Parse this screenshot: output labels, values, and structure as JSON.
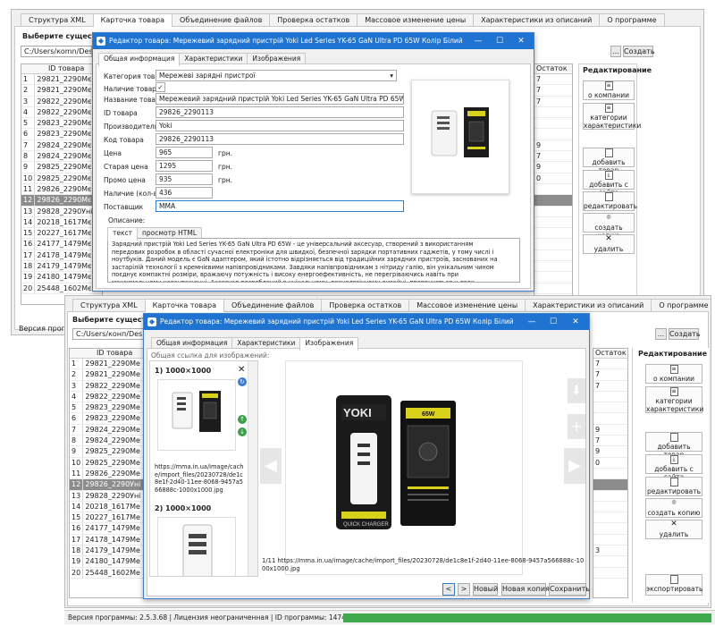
{
  "main_tabs": [
    "Структура XML",
    "Карточка товара",
    "Объединение файлов",
    "Проверка остатков",
    "Массовое изменение цены",
    "Характеристики из описаний",
    "О программе"
  ],
  "select_label": "Выберите существую",
  "path_value": "C:/Users/коmn/Desktop",
  "path2_value": "C:/Users/конп/Desktop",
  "browse_label": "...",
  "create_label": "Создать",
  "col_id": "ID товара",
  "col_stock": "Остаток",
  "rows1": [
    {
      "n": "1",
      "id": "29821_2290...",
      "m": "Мє",
      "s": "7"
    },
    {
      "n": "2",
      "id": "29821_2290...",
      "m": "Мє",
      "s": "7"
    },
    {
      "n": "3",
      "id": "29822_2290...",
      "m": "Мє",
      "s": "7"
    },
    {
      "n": "4",
      "id": "29822_2290...",
      "m": "Мє",
      "s": ""
    },
    {
      "n": "5",
      "id": "29823_2290...",
      "m": "Мє",
      "s": ""
    },
    {
      "n": "6",
      "id": "29823_2290...",
      "m": "Мє",
      "s": ""
    },
    {
      "n": "7",
      "id": "29824_2290...",
      "m": "Мє",
      "s": "9"
    },
    {
      "n": "8",
      "id": "29824_2290...",
      "m": "Мє",
      "s": "7"
    },
    {
      "n": "9",
      "id": "29825_2290...",
      "m": "Мє",
      "s": "9"
    },
    {
      "n": "10",
      "id": "29825_2290...",
      "m": "Мє",
      "s": "0"
    },
    {
      "n": "11",
      "id": "29826_2290...",
      "m": "Мє",
      "s": ""
    },
    {
      "n": "12",
      "id": "29826_2290...",
      "m": "Мє",
      "s": "",
      "sel": true
    },
    {
      "n": "13",
      "id": "29828_2290...",
      "m": "Уні",
      "s": ""
    },
    {
      "n": "14",
      "id": "20218_161784",
      "m": "Мє",
      "s": ""
    },
    {
      "n": "15",
      "id": "20227_161793",
      "m": "Мє",
      "s": ""
    },
    {
      "n": "16",
      "id": "24177_1479...",
      "m": "Мє",
      "s": ""
    },
    {
      "n": "17",
      "id": "24178_1479...",
      "m": "Мє",
      "s": ""
    },
    {
      "n": "18",
      "id": "24179_1479...",
      "m": "Мє",
      "s": ""
    },
    {
      "n": "19",
      "id": "24180_1479",
      "m": "Мє",
      "s": ""
    },
    {
      "n": "20",
      "id": "25448_1602",
      "m": "Мє",
      "s": ""
    }
  ],
  "rows2": [
    {
      "n": "1",
      "id": "29821_2290...",
      "m": "Ме",
      "s": "7"
    },
    {
      "n": "2",
      "id": "29821_2290...",
      "m": "Ме",
      "s": "7"
    },
    {
      "n": "3",
      "id": "29822_2290...",
      "m": "Ме",
      "s": "7"
    },
    {
      "n": "4",
      "id": "29822_2290...",
      "m": "Ме",
      "s": ""
    },
    {
      "n": "5",
      "id": "29823_2290...",
      "m": "Ме",
      "s": ""
    },
    {
      "n": "6",
      "id": "29823_2290...",
      "m": "Ме",
      "s": ""
    },
    {
      "n": "7",
      "id": "29824_2290...",
      "m": "Ме",
      "s": "9"
    },
    {
      "n": "8",
      "id": "29824_2290...",
      "m": "Ме",
      "s": "7"
    },
    {
      "n": "9",
      "id": "29825_2290...",
      "m": "Ме",
      "s": "9"
    },
    {
      "n": "10",
      "id": "29825_2290...",
      "m": "Ме",
      "s": "0"
    },
    {
      "n": "11",
      "id": "29826_2290...",
      "m": "Ме",
      "s": ""
    },
    {
      "n": "12",
      "id": "29826_2290...",
      "m": "Уні",
      "s": "",
      "sel": true
    },
    {
      "n": "13",
      "id": "29828_2290...",
      "m": "Уні",
      "s": ""
    },
    {
      "n": "14",
      "id": "20218_161784",
      "m": "Ме",
      "s": ""
    },
    {
      "n": "15",
      "id": "20227_161793",
      "m": "Ме",
      "s": ""
    },
    {
      "n": "16",
      "id": "24177_1479...",
      "m": "Ме",
      "s": ""
    },
    {
      "n": "17",
      "id": "24178_1479...",
      "m": "Ме",
      "s": ""
    },
    {
      "n": "18",
      "id": "24179_1479...",
      "m": "Ме",
      "s": "3"
    },
    {
      "n": "19",
      "id": "24180_1479...",
      "m": "Ме",
      "s": ""
    },
    {
      "n": "20",
      "id": "25448_1602",
      "m": "Ме",
      "s": ""
    }
  ],
  "panel": {
    "title": "Редактирование",
    "b1": "о компании",
    "b2": "категории характеристики",
    "b3": "добавить товар",
    "b4": "добавить с сайта",
    "b5": "редактировать",
    "b6": "создать копию",
    "b7": "удалить",
    "b8": "экспортировать"
  },
  "version_left": "Версия програм",
  "status_bar": "Версия программы: 2.5.3.68 | Лицензия неограниченная | ID программы: 1474 | Статус задачи:",
  "dlg_title": "Редактор товара: Мережевий зарядний пристрій Yoki Led Series YK-65 GaN Ultra PD 65W Колір Білий",
  "dlg_tabs": [
    "Общая информация",
    "Характеристики",
    "Изображения"
  ],
  "form": {
    "cat_label": "Категория товара",
    "cat_value": "Мережеві зарядні пристрої",
    "avail_label": "Наличие товара",
    "avail_check": "✓",
    "name_label": "Название товара",
    "name_value": "Мережевий зарядний пристрій Yoki Led Series YK-65 GaN Ultra PD 65W Колір Білий",
    "id_label": "ID товара",
    "id_value": "29826_2290113",
    "mfr_label": "Производитель",
    "mfr_value": "Yoki",
    "code_label": "Код товара",
    "code_value": "29826_2290113",
    "price_label": "Цена",
    "price_value": "965",
    "cur1": "грн.",
    "old_label": "Старая цена",
    "old_value": "1295",
    "cur2": "грн.",
    "promo_label": "Промо цена",
    "promo_value": "935",
    "cur3": "грн.",
    "qty_label": "Наличие (кол-во)",
    "qty_value": "436",
    "sup_label": "Поставщик",
    "sup_value": "MMA",
    "desc_label": "Описание:",
    "desc_tab1": "текст",
    "desc_tab2": "просмотр HTML",
    "desc_text": "Зарядний пристрій Yoki Led Series YK-65 GaN Ultra PD 65W - це універсальний аксесуар, створений з використанням передових розробок в області сучасної електроніки для швидкої, безпечної зарядки портативних гаджетів, у тому числі і ноутбуків. Даний модель є GaN адаптером, який істотно відрізняється від традиційних зарядних пристроїв, заснованих на застарілій технології з кремнієвими напівпровідниками. Завдяки напівпровідникам з нітриду галію, він унікальним чином поєднує компактні розміри, вражаючу потужність і високу енергоефективність, не перегріваючись навіть при максимальному навантаженні. Аксесуар розроблений в унікальному, технологічному дизайні, пропонується у двох"
  },
  "img": {
    "common_label": "Общая ссылка для изображений:",
    "item1_label": "1)  1000×1000",
    "item1_url": "https://mma.in.ua/image/cache/import_files/20230728/de1c8e1f-2d40-11ee-8068-9457a566888c-1000x1000.jpg",
    "item2_label": "2)  1000×1000",
    "footer_url": "1/11 https://mma.in.ua/image/cache/import_files/20230728/de1c8e1f-2d40-11ee-8068-9457a566888c-1000x1000.jpg",
    "btn_prev": "<",
    "btn_next": ">",
    "btn_new": "Новый",
    "btn_copy": "Новая копия",
    "btn_save": "Сохранить"
  },
  "product": {
    "brand": "YOKI",
    "model": "65W",
    "box_text": "QUICK CHARGER"
  },
  "icons": {
    "minimize": "minimize-icon",
    "maximize": "maximize-icon",
    "close": "close-icon"
  }
}
